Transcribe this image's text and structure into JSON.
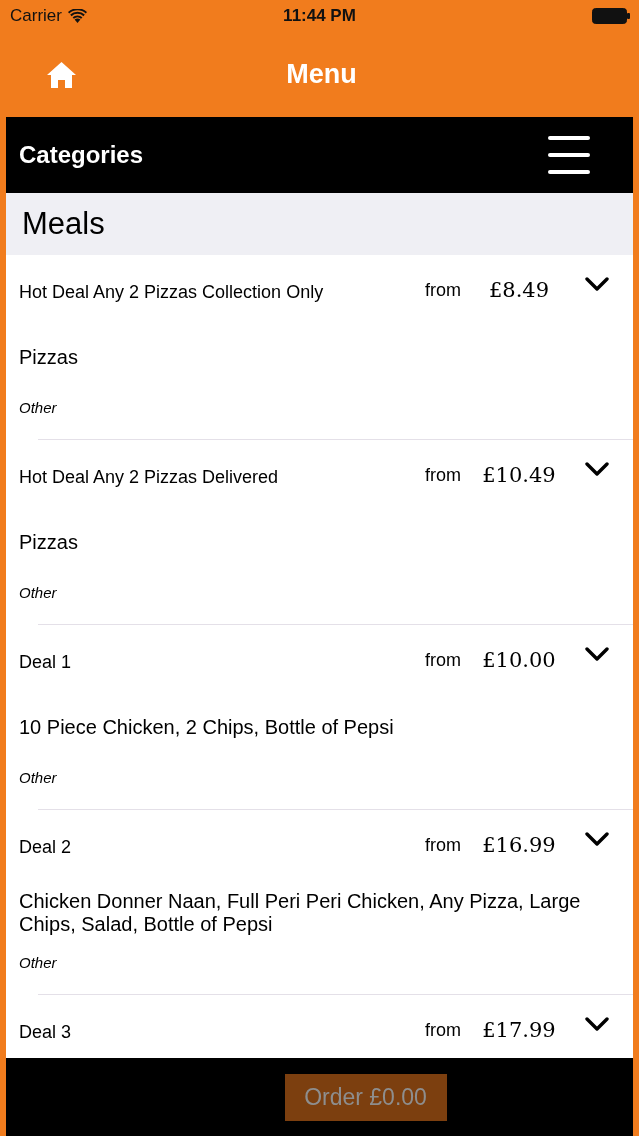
{
  "status_bar": {
    "carrier": "Carrier",
    "time": "11:44 PM"
  },
  "nav": {
    "title": "Menu"
  },
  "categories": {
    "title": "Categories"
  },
  "section": {
    "title": "Meals"
  },
  "items": [
    {
      "name": "Hot Deal Any 2 Pizzas Collection Only",
      "from": "from",
      "price": "£8.49",
      "description": "Pizzas",
      "category": "Other"
    },
    {
      "name": "Hot Deal Any 2 Pizzas Delivered",
      "from": "from",
      "price": "£10.49",
      "description": "Pizzas",
      "category": "Other"
    },
    {
      "name": "Deal 1",
      "from": "from",
      "price": "£10.00",
      "description": "10 Piece Chicken, 2 Chips, Bottle of Pepsi",
      "category": "Other"
    },
    {
      "name": "Deal 2",
      "from": "from",
      "price": "£16.99",
      "description": "Chicken Donner Naan, Full Peri Peri Chicken, Any Pizza, Large Chips, Salad, Bottle of Pepsi",
      "category": "Other"
    },
    {
      "name": "Deal 3",
      "from": "from",
      "price": "£17.99"
    }
  ],
  "order_button": {
    "label": "Order £0.00",
    "disabled": true
  }
}
